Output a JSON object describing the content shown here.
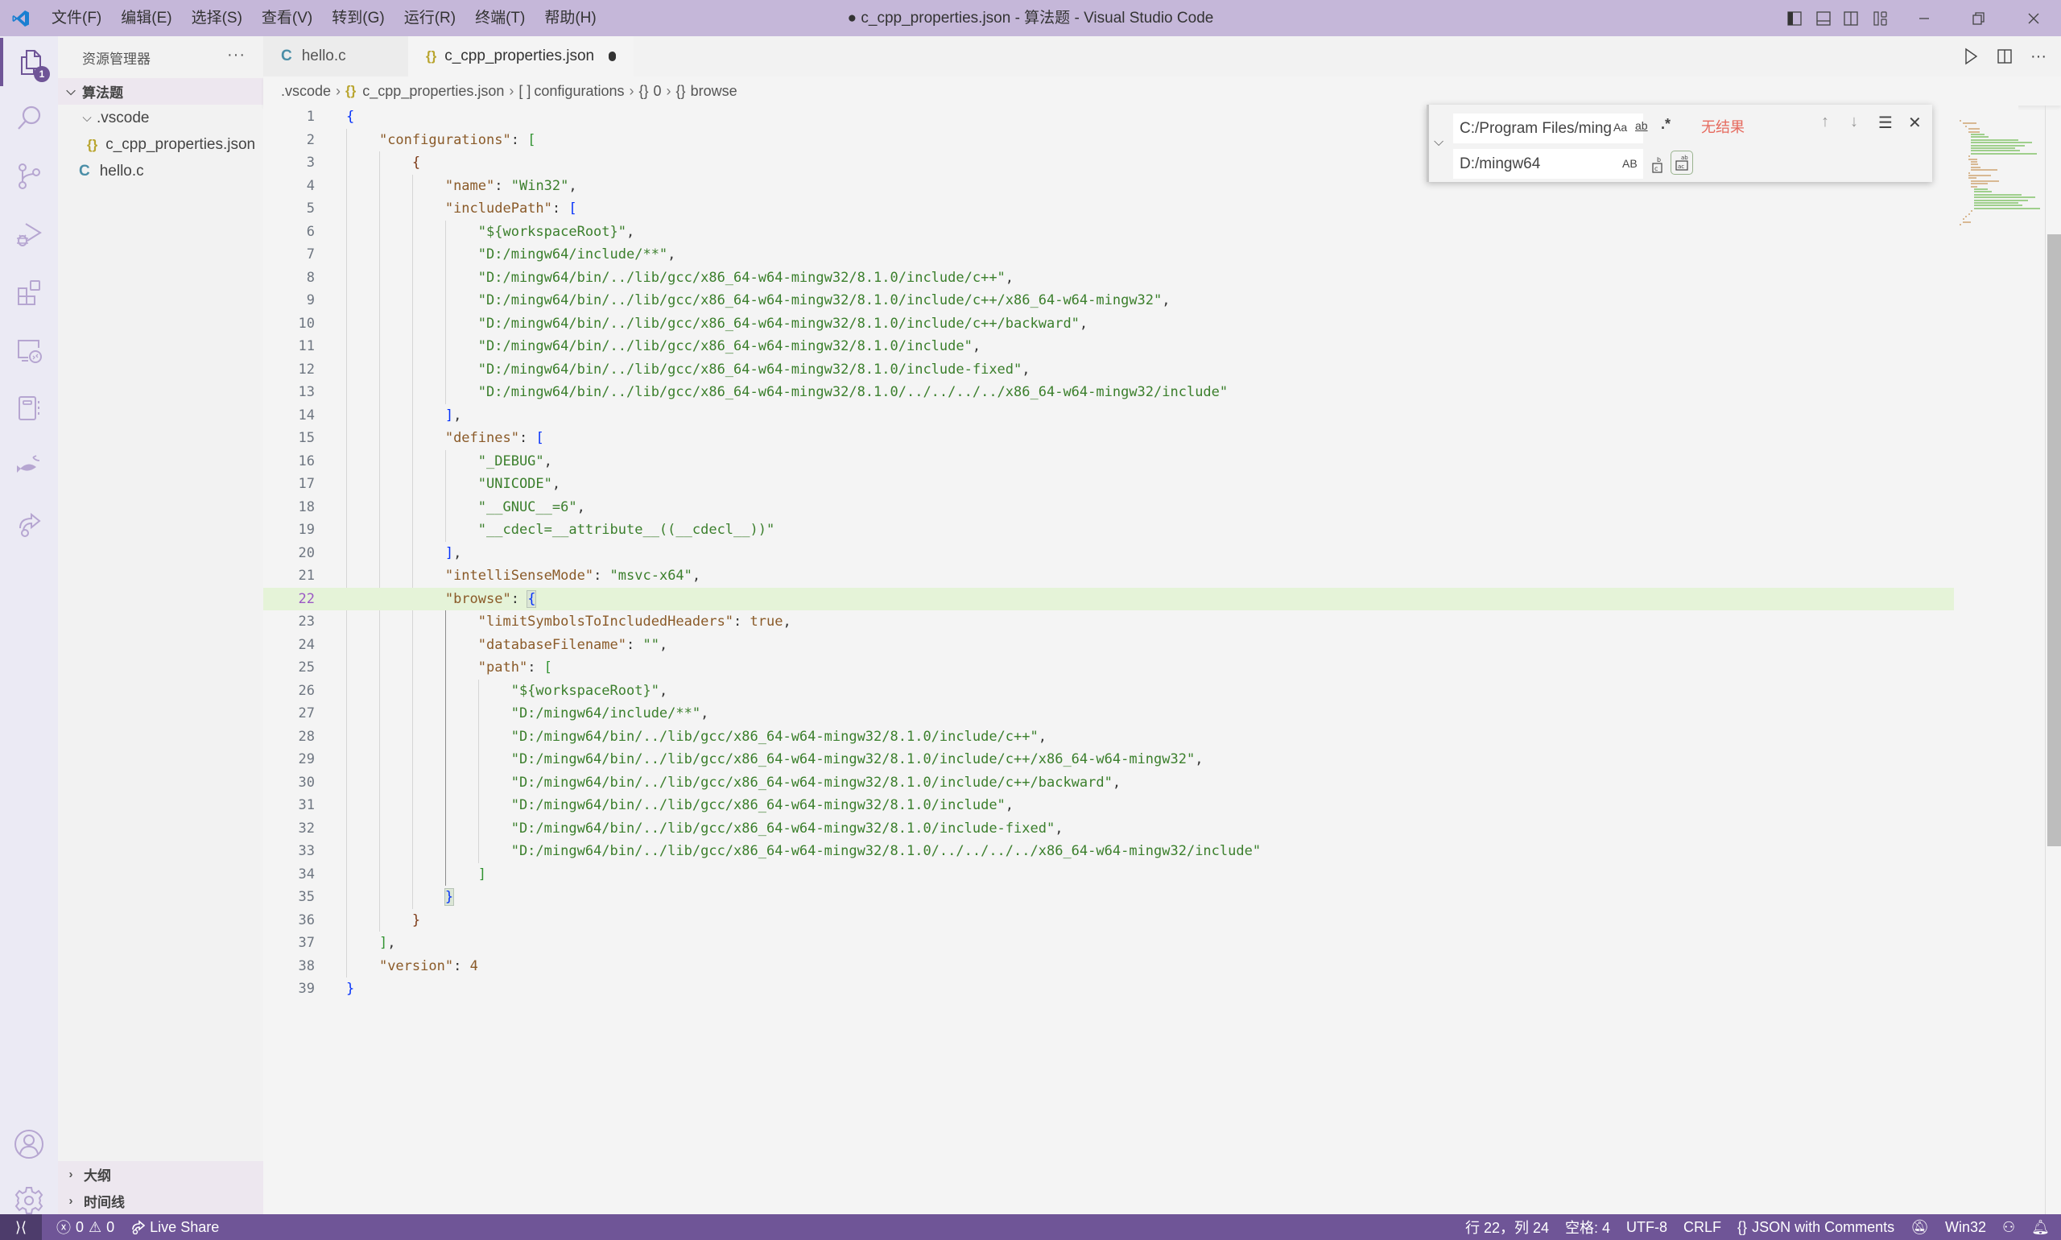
{
  "window": {
    "title": "● c_cpp_properties.json - 算法题 - Visual Studio Code",
    "menu": [
      "文件(F)",
      "编辑(E)",
      "选择(S)",
      "查看(V)",
      "转到(G)",
      "运行(R)",
      "终端(T)",
      "帮助(H)"
    ]
  },
  "activity_bar": {
    "items": [
      {
        "name": "explorer",
        "icon": "files-icon",
        "badge": "1",
        "active": true
      },
      {
        "name": "search",
        "icon": "search-icon"
      },
      {
        "name": "source-control",
        "icon": "source-control-icon"
      },
      {
        "name": "run-debug",
        "icon": "run-debug-icon"
      },
      {
        "name": "extensions",
        "icon": "extensions-icon"
      },
      {
        "name": "remote-explorer",
        "icon": "remote-explorer-icon"
      },
      {
        "name": "notebook",
        "icon": "notebook-icon"
      },
      {
        "name": "fish",
        "icon": "fish-icon"
      },
      {
        "name": "live-share",
        "icon": "live-share-icon"
      }
    ],
    "bottom": [
      {
        "name": "accounts",
        "icon": "account-icon"
      },
      {
        "name": "manage",
        "icon": "gear-icon"
      }
    ]
  },
  "sidebar": {
    "title": "资源管理器",
    "more": "···",
    "root": "算法题",
    "tree": [
      {
        "label": ".vscode",
        "type": "folder",
        "expanded": true,
        "depth": 1
      },
      {
        "label": "c_cpp_properties.json",
        "type": "json",
        "depth": 2
      },
      {
        "label": "hello.c",
        "type": "c",
        "depth": 1
      }
    ],
    "sections": [
      "大纲",
      "时间线"
    ]
  },
  "tabs": [
    {
      "label": "hello.c",
      "icon": "C",
      "active": false
    },
    {
      "label": "c_cpp_properties.json",
      "icon": "{}",
      "active": true,
      "dirty": true
    }
  ],
  "breadcrumb": [
    ".vscode",
    "c_cpp_properties.json",
    "configurations",
    "0",
    "browse"
  ],
  "breadcrumb_icons": [
    "",
    "{}",
    "[ ]",
    "{}",
    "{}"
  ],
  "find_widget": {
    "find_value": "C:/Program Files/ming",
    "replace_value": "D:/mingw64",
    "match_case": "Aa",
    "whole_word": "ab",
    "regex": ".*",
    "preserve_case": "AB",
    "result": "无结果"
  },
  "editor": {
    "current_line": 22,
    "lines": [
      "{",
      "    \"configurations\": [",
      "        {",
      "            \"name\": \"Win32\",",
      "            \"includePath\": [",
      "                \"${workspaceRoot}\",",
      "                \"D:/mingw64/include/**\",",
      "                \"D:/mingw64/bin/../lib/gcc/x86_64-w64-mingw32/8.1.0/include/c++\",",
      "                \"D:/mingw64/bin/../lib/gcc/x86_64-w64-mingw32/8.1.0/include/c++/x86_64-w64-mingw32\",",
      "                \"D:/mingw64/bin/../lib/gcc/x86_64-w64-mingw32/8.1.0/include/c++/backward\",",
      "                \"D:/mingw64/bin/../lib/gcc/x86_64-w64-mingw32/8.1.0/include\",",
      "                \"D:/mingw64/bin/../lib/gcc/x86_64-w64-mingw32/8.1.0/include-fixed\",",
      "                \"D:/mingw64/bin/../lib/gcc/x86_64-w64-mingw32/8.1.0/../../../../x86_64-w64-mingw32/include\"",
      "            ],",
      "            \"defines\": [",
      "                \"_DEBUG\",",
      "                \"UNICODE\",",
      "                \"__GNUC__=6\",",
      "                \"__cdecl=__attribute__((__cdecl__))\"",
      "            ],",
      "            \"intelliSenseMode\": \"msvc-x64\",",
      "            \"browse\": {",
      "                \"limitSymbolsToIncludedHeaders\": true,",
      "                \"databaseFilename\": \"\",",
      "                \"path\": [",
      "                    \"${workspaceRoot}\",",
      "                    \"D:/mingw64/include/**\",",
      "                    \"D:/mingw64/bin/../lib/gcc/x86_64-w64-mingw32/8.1.0/include/c++\",",
      "                    \"D:/mingw64/bin/../lib/gcc/x86_64-w64-mingw32/8.1.0/include/c++/x86_64-w64-mingw32\",",
      "                    \"D:/mingw64/bin/../lib/gcc/x86_64-w64-mingw32/8.1.0/include/c++/backward\",",
      "                    \"D:/mingw64/bin/../lib/gcc/x86_64-w64-mingw32/8.1.0/include\",",
      "                    \"D:/mingw64/bin/../lib/gcc/x86_64-w64-mingw32/8.1.0/include-fixed\",",
      "                    \"D:/mingw64/bin/../lib/gcc/x86_64-w64-mingw32/8.1.0/../../../../x86_64-w64-mingw32/include\"",
      "                ]",
      "            }",
      "        }",
      "    ],",
      "    \"version\": 4",
      "}"
    ]
  },
  "status_bar": {
    "errors": "0",
    "warnings": "0",
    "live_share": "Live Share",
    "cursor": "行 22，列 24",
    "indent": "空格: 4",
    "encoding": "UTF-8",
    "eol": "CRLF",
    "language": "JSON with Comments",
    "platform": "Win32"
  },
  "colors": {
    "title_bar": "#c5b7d9",
    "status_bar": "#6f5597",
    "key": "#8a5a28",
    "string": "#3b7f2c",
    "bracket_1": "#0431fa",
    "bracket_2": "#319331",
    "bracket_3": "#7b3814",
    "current_line": "#e5f3d8",
    "no_results": "#e66a5e"
  }
}
